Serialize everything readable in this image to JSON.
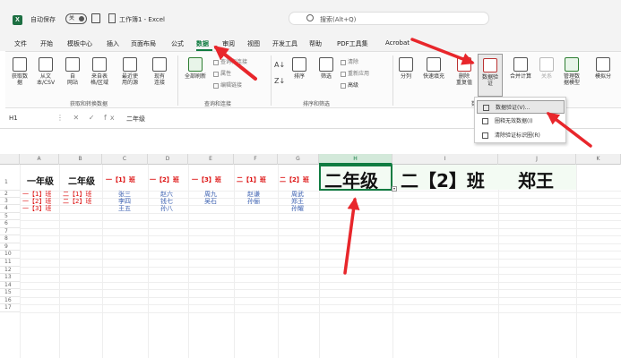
{
  "titlebar": {
    "app_icon": "excel-logo-icon",
    "autosave_label": "自动保存",
    "autosave_state": "关",
    "doc_title": "工作簿1 - Excel",
    "search_placeholder": "搜索(Alt+Q)"
  },
  "menu": {
    "tabs": [
      "文件",
      "开始",
      "模板中心",
      "插入",
      "页面布局",
      "公式",
      "数据",
      "审阅",
      "视图",
      "开发工具",
      "帮助",
      "PDF工具集",
      "Acrobat"
    ],
    "active": "数据"
  },
  "ribbon": {
    "get_data": "获取数\n据",
    "from_text": "从文\n本/CSV",
    "from_web": "自\n网站",
    "from_table": "来自表\n格/区域",
    "recent": "最近使\n用的源",
    "existing": "现有\n连接",
    "refresh_all": "全部刷新",
    "queries": "查询和连接",
    "props": "属性",
    "edit_links": "编辑链接",
    "sort": "排序",
    "filter": "筛选",
    "clear": "清除",
    "reapply": "重新应用",
    "advanced": "高级",
    "split": "分列",
    "flash_fill": "快速填充",
    "remove_dup": "删除\n重复值",
    "data_validation": "数据验\n证",
    "consolidate": "合并计算",
    "relations": "关系",
    "manage_model": "管理数\n据模型",
    "whatif": "模拟分",
    "group_get": "获取和转换数据",
    "group_query": "查询和连接",
    "group_sort": "排序和筛选",
    "group_tools": "数"
  },
  "dropdown": {
    "items": [
      "数据验证(V)...",
      "圈释无效数据(I)",
      "清除验证标识圈(R)"
    ]
  },
  "formula_bar": {
    "name_box": "H1",
    "formula": "二年级"
  },
  "columns": [
    "A",
    "B",
    "C",
    "D",
    "E",
    "F",
    "G",
    "H",
    "I",
    "J",
    "K"
  ],
  "rows": [
    "1",
    "2",
    "3",
    "4",
    "5",
    "6",
    "7",
    "8",
    "9",
    "10",
    "11",
    "12",
    "13",
    "14",
    "15",
    "16",
    "17"
  ],
  "sheet": {
    "headers": [
      "一年级",
      "二年级",
      "一【1】班",
      "一【2】班",
      "一【3】班",
      "二【1】班",
      "二【2】班"
    ],
    "colA": [
      "一【1】班",
      "一【2】班",
      "一【3】班"
    ],
    "colB": [
      "二【1】班",
      "二【2】班"
    ],
    "colC": [
      "张三",
      "李四",
      "王五"
    ],
    "colD": [
      "赵六",
      "钱七",
      "孙八"
    ],
    "colE": [
      "周九",
      "吴石"
    ],
    "colF": [
      "赵谦",
      "孙俪"
    ],
    "colG": [
      "周武",
      "郑王",
      "孙耀"
    ],
    "merged": [
      "二年级",
      "二【2】班",
      "郑王"
    ]
  }
}
